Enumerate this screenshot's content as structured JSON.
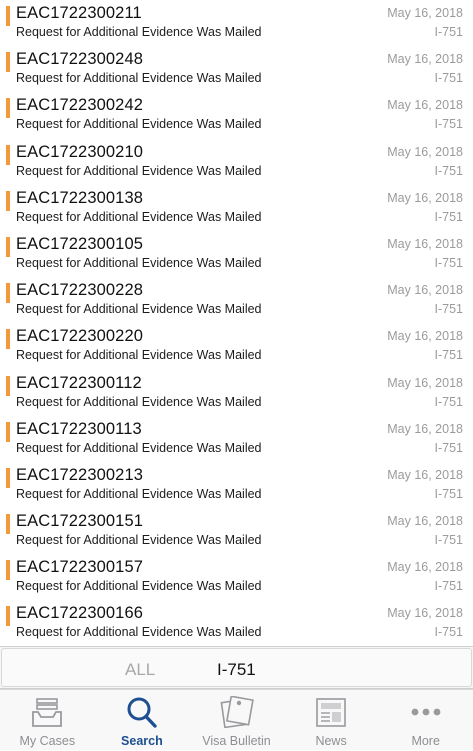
{
  "cases": [
    {
      "id": "EAC1722300211",
      "status": "Request for Additional Evidence Was Mailed",
      "date": "May 16, 2018",
      "form": "I-751"
    },
    {
      "id": "EAC1722300248",
      "status": "Request for Additional Evidence Was Mailed",
      "date": "May 16, 2018",
      "form": "I-751"
    },
    {
      "id": "EAC1722300242",
      "status": "Request for Additional Evidence Was Mailed",
      "date": "May 16, 2018",
      "form": "I-751"
    },
    {
      "id": "EAC1722300210",
      "status": "Request for Additional Evidence Was Mailed",
      "date": "May 16, 2018",
      "form": "I-751"
    },
    {
      "id": "EAC1722300138",
      "status": "Request for Additional Evidence Was Mailed",
      "date": "May 16, 2018",
      "form": "I-751"
    },
    {
      "id": "EAC1722300105",
      "status": "Request for Additional Evidence Was Mailed",
      "date": "May 16, 2018",
      "form": "I-751"
    },
    {
      "id": "EAC1722300228",
      "status": "Request for Additional Evidence Was Mailed",
      "date": "May 16, 2018",
      "form": "I-751"
    },
    {
      "id": "EAC1722300220",
      "status": "Request for Additional Evidence Was Mailed",
      "date": "May 16, 2018",
      "form": "I-751"
    },
    {
      "id": "EAC1722300112",
      "status": "Request for Additional Evidence Was Mailed",
      "date": "May 16, 2018",
      "form": "I-751"
    },
    {
      "id": "EAC1722300113",
      "status": "Request for Additional Evidence Was Mailed",
      "date": "May 16, 2018",
      "form": "I-751"
    },
    {
      "id": "EAC1722300213",
      "status": "Request for Additional Evidence Was Mailed",
      "date": "May 16, 2018",
      "form": "I-751"
    },
    {
      "id": "EAC1722300151",
      "status": "Request for Additional Evidence Was Mailed",
      "date": "May 16, 2018",
      "form": "I-751"
    },
    {
      "id": "EAC1722300157",
      "status": "Request for Additional Evidence Was Mailed",
      "date": "May 16, 2018",
      "form": "I-751"
    },
    {
      "id": "EAC1722300166",
      "status": "Request for Additional Evidence Was Mailed",
      "date": "May 16, 2018",
      "form": "I-751"
    }
  ],
  "status_color": "#f29a3a",
  "filter": {
    "options": [
      "ALL",
      "I-751"
    ],
    "selected": "I-751"
  },
  "tabs": [
    {
      "label": "My Cases",
      "icon": "inbox-tray-icon"
    },
    {
      "label": "Search",
      "icon": "magnifier-icon",
      "active": true
    },
    {
      "label": "Visa Bulletin",
      "icon": "pinned-note-icon"
    },
    {
      "label": "News",
      "icon": "newspaper-icon"
    },
    {
      "label": "More",
      "icon": "ellipsis-icon"
    }
  ],
  "accent_color": "#1d4f91"
}
